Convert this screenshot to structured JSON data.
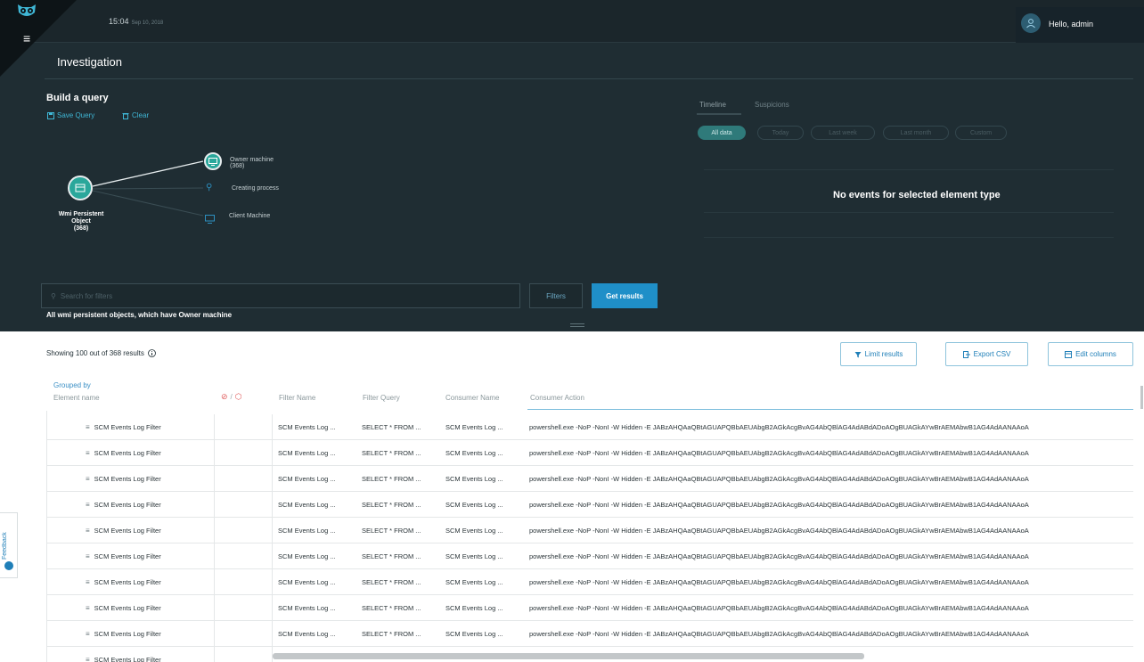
{
  "header": {
    "time": "15:04",
    "date": "Sep 10, 2018",
    "greeting": "Hello, admin"
  },
  "page_title": "Investigation",
  "query_builder": {
    "title": "Build a query",
    "save_label": "Save Query",
    "clear_label": "Clear",
    "root_node": {
      "label_line1": "Wmi Persistent",
      "label_line2": "Object",
      "label_line3": "(368)"
    },
    "branches": [
      {
        "label_line1": "Owner machine",
        "label_line2": "(368)",
        "icon": "monitor-icon"
      },
      {
        "label_line1": "Creating process",
        "label_line2": "",
        "icon": "process-icon"
      },
      {
        "label_line1": "Client Machine",
        "label_line2": "",
        "icon": "monitor-icon"
      }
    ]
  },
  "timeline": {
    "tabs": [
      "Timeline",
      "Suspicions"
    ],
    "ranges": [
      "All data",
      "Today",
      "Last week",
      "Last month",
      "Custom"
    ],
    "active_range": "All data",
    "empty_message": "No events for selected element type"
  },
  "search": {
    "placeholder": "Search for filters",
    "filters_label": "Filters",
    "get_results_label": "Get results",
    "summary": "All wmi persistent objects, which have Owner machine"
  },
  "results": {
    "showing": "Showing 100 out of 368 results",
    "limit_label": "Limit results",
    "export_label": "Export CSV",
    "edit_label": "Edit columns",
    "grouped_by": "Grouped by",
    "columns": {
      "element_name": "Element name",
      "filter_name": "Filter Name",
      "filter_query": "Filter Query",
      "consumer_name": "Consumer Name",
      "consumer_action": "Consumer Action"
    },
    "rows": [
      {
        "name": "SCM Events Log Filter",
        "filter_name": "SCM Events Log ...",
        "filter_query": "SELECT * FROM ...",
        "consumer_name": "SCM Events Log ...",
        "consumer_action": "powershell.exe -NoP -NonI -W Hidden -E JABzAHQAaQBtAGUAPQBbAEUAbgB2AGkAcgBvAG4AbQBlAG4AdABdADoAOgBUAGkAYwBrAEMAbwB1AG4AdAANAAoA"
      },
      {
        "name": "SCM Events Log Filter",
        "filter_name": "SCM Events Log ...",
        "filter_query": "SELECT * FROM ...",
        "consumer_name": "SCM Events Log ...",
        "consumer_action": "powershell.exe -NoP -NonI -W Hidden -E JABzAHQAaQBtAGUAPQBbAEUAbgB2AGkAcgBvAG4AbQBlAG4AdABdADoAOgBUAGkAYwBrAEMAbwB1AG4AdAANAAoA"
      },
      {
        "name": "SCM Events Log Filter",
        "filter_name": "SCM Events Log ...",
        "filter_query": "SELECT * FROM ...",
        "consumer_name": "SCM Events Log ...",
        "consumer_action": "powershell.exe -NoP -NonI -W Hidden -E JABzAHQAaQBtAGUAPQBbAEUAbgB2AGkAcgBvAG4AbQBlAG4AdABdADoAOgBUAGkAYwBrAEMAbwB1AG4AdAANAAoA"
      },
      {
        "name": "SCM Events Log Filter",
        "filter_name": "SCM Events Log ...",
        "filter_query": "SELECT * FROM ...",
        "consumer_name": "SCM Events Log ...",
        "consumer_action": "powershell.exe -NoP -NonI -W Hidden -E JABzAHQAaQBtAGUAPQBbAEUAbgB2AGkAcgBvAG4AbQBlAG4AdABdADoAOgBUAGkAYwBrAEMAbwB1AG4AdAANAAoA"
      },
      {
        "name": "SCM Events Log Filter",
        "filter_name": "SCM Events Log ...",
        "filter_query": "SELECT * FROM ...",
        "consumer_name": "SCM Events Log ...",
        "consumer_action": "powershell.exe -NoP -NonI -W Hidden -E JABzAHQAaQBtAGUAPQBbAEUAbgB2AGkAcgBvAG4AbQBlAG4AdABdADoAOgBUAGkAYwBrAEMAbwB1AG4AdAANAAoA"
      },
      {
        "name": "SCM Events Log Filter",
        "filter_name": "SCM Events Log ...",
        "filter_query": "SELECT * FROM ...",
        "consumer_name": "SCM Events Log ...",
        "consumer_action": "powershell.exe -NoP -NonI -W Hidden -E JABzAHQAaQBtAGUAPQBbAEUAbgB2AGkAcgBvAG4AbQBlAG4AdABdADoAOgBUAGkAYwBrAEMAbwB1AG4AdAANAAoA"
      },
      {
        "name": "SCM Events Log Filter",
        "filter_name": "SCM Events Log ...",
        "filter_query": "SELECT * FROM ...",
        "consumer_name": "SCM Events Log ...",
        "consumer_action": "powershell.exe -NoP -NonI -W Hidden -E JABzAHQAaQBtAGUAPQBbAEUAbgB2AGkAcgBvAG4AbQBlAG4AdABdADoAOgBUAGkAYwBrAEMAbwB1AG4AdAANAAoA"
      },
      {
        "name": "SCM Events Log Filter",
        "filter_name": "SCM Events Log ...",
        "filter_query": "SELECT * FROM ...",
        "consumer_name": "SCM Events Log ...",
        "consumer_action": "powershell.exe -NoP -NonI -W Hidden -E JABzAHQAaQBtAGUAPQBbAEUAbgB2AGkAcgBvAG4AbQBlAG4AdABdADoAOgBUAGkAYwBrAEMAbwB1AG4AdAANAAoA"
      },
      {
        "name": "SCM Events Log Filter",
        "filter_name": "SCM Events Log ...",
        "filter_query": "SELECT * FROM ...",
        "consumer_name": "SCM Events Log ...",
        "consumer_action": "powershell.exe -NoP -NonI -W Hidden -E JABzAHQAaQBtAGUAPQBbAEUAbgB2AGkAcgBvAG4AbQBlAG4AdABdADoAOgBUAGkAYwBrAEMAbwB1AG4AdAANAAoA"
      },
      {
        "name": "SCM Events Log Filter",
        "filter_name": "",
        "filter_query": "",
        "consumer_name": "",
        "consumer_action": ""
      }
    ]
  },
  "feedback_label": "Feedback",
  "colors": {
    "dark_bg": "#1f2d33",
    "accent": "#1f8fc8",
    "node_teal": "#2aa79b",
    "link_blue": "#3fb7d6"
  }
}
